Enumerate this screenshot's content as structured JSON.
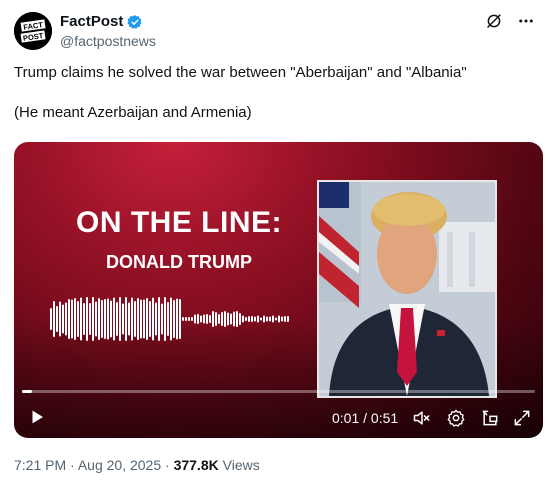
{
  "author": {
    "display_name": "FactPost",
    "handle": "@factpostnews",
    "avatar_text_top": "FACT",
    "avatar_text_bottom": "POST"
  },
  "tweet": {
    "line1": "Trump claims he solved the war between \"Aberbaijan\" and \"Albania\"",
    "line2": "(He meant Azerbaijan and Armenia)"
  },
  "video": {
    "headline": "ON THE LINE:",
    "subline": "DONALD TRUMP",
    "time": "0:01 / 0:51",
    "progress": 0.02
  },
  "meta": {
    "time": "7:21 PM",
    "date": "Aug 20, 2025",
    "views_count": "377.8K",
    "views_label": "Views",
    "separator": "·"
  },
  "colors": {
    "verified": "#1d9bf0",
    "media_red": "#8c0f22",
    "text_secondary": "#536471"
  }
}
